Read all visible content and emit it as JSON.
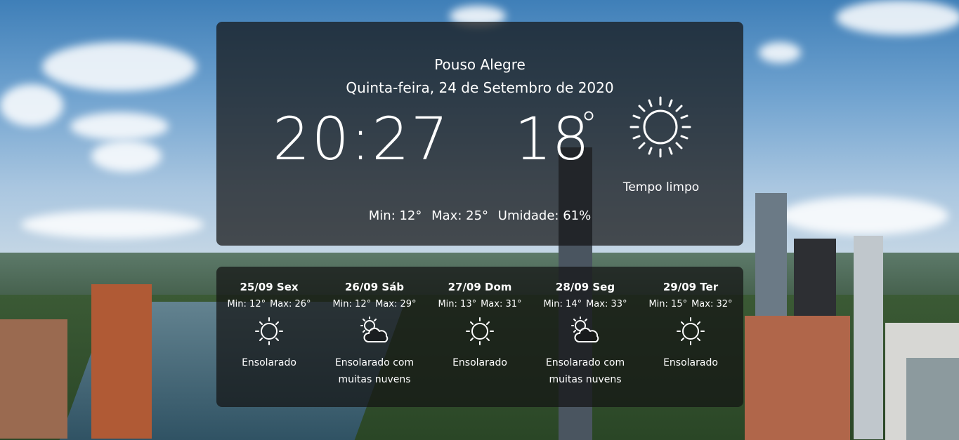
{
  "location": {
    "city": "Pouso Alegre",
    "date": "Quinta-feira, 24 de Setembro de 2020"
  },
  "current": {
    "time": "20:27",
    "temperature": "18",
    "degree_symbol": "°",
    "condition": "Tempo limpo",
    "icon": "sun-icon",
    "min_label": "Min: 12°",
    "max_label": "Max: 25°",
    "humidity_label": "Umidade: 61%"
  },
  "forecast": [
    {
      "label": "25/09 Sex",
      "min": "Min: 12°",
      "max": "Max: 26°",
      "icon": "sun-icon",
      "desc": "Ensolarado"
    },
    {
      "label": "26/09 Sáb",
      "min": "Min: 12°",
      "max": "Max: 29°",
      "icon": "sun-cloud-icon",
      "desc": "Ensolarado com muitas nuvens"
    },
    {
      "label": "27/09 Dom",
      "min": "Min: 13°",
      "max": "Max: 31°",
      "icon": "sun-icon",
      "desc": "Ensolarado"
    },
    {
      "label": "28/09 Seg",
      "min": "Min: 14°",
      "max": "Max: 33°",
      "icon": "sun-cloud-icon",
      "desc": "Ensolarado com muitas nuvens"
    },
    {
      "label": "29/09 Ter",
      "min": "Min: 15°",
      "max": "Max: 32°",
      "icon": "sun-icon",
      "desc": "Ensolarado"
    }
  ]
}
